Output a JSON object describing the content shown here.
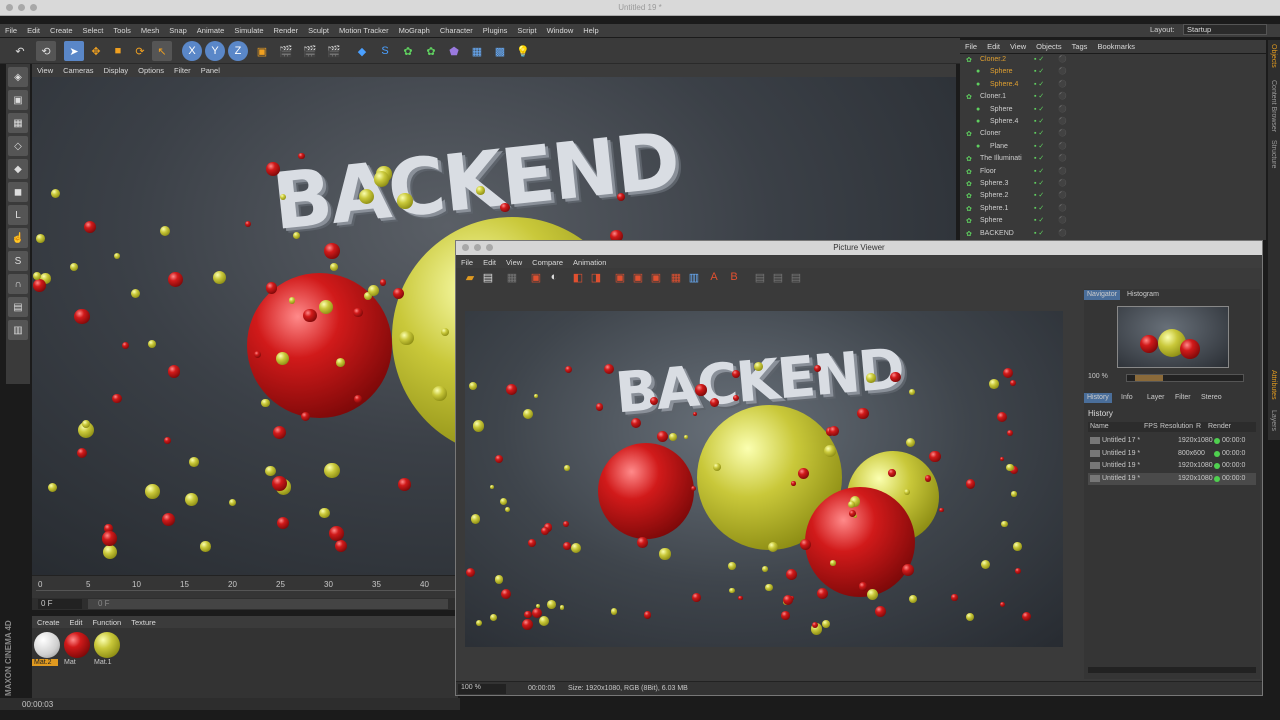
{
  "window": {
    "title": "Untitled 19 *"
  },
  "menus": [
    "File",
    "Edit",
    "Create",
    "Select",
    "Tools",
    "Mesh",
    "Snap",
    "Animate",
    "Simulate",
    "Render",
    "Sculpt",
    "Motion Tracker",
    "MoGraph",
    "Character",
    "Plugins",
    "Script",
    "Window",
    "Help"
  ],
  "layout": {
    "label": "Layout:",
    "value": "Startup"
  },
  "viewport": {
    "menus": [
      "View",
      "Cameras",
      "Display",
      "Options",
      "Filter",
      "Panel"
    ],
    "scene_text": "BACKEND"
  },
  "timeline": {
    "ticks": [
      "0",
      "5",
      "10",
      "15",
      "20",
      "25",
      "30",
      "35",
      "40"
    ],
    "frame": "0 F",
    "frame2": "0 F"
  },
  "materials": {
    "menus": [
      "Create",
      "Edit",
      "Function",
      "Texture"
    ],
    "items": [
      "Mat.2",
      "Mat",
      "Mat.1"
    ]
  },
  "status": {
    "time": "00:00:03"
  },
  "brand": "MAXON CINEMA 4D",
  "objects": {
    "menus": [
      "File",
      "Edit",
      "View",
      "Objects",
      "Tags",
      "Bookmarks"
    ],
    "items": [
      {
        "name": "Cloner.2",
        "indent": 0,
        "color": "#e0a030"
      },
      {
        "name": "Sphere",
        "indent": 1,
        "color": "#e0a030"
      },
      {
        "name": "Sphere.4",
        "indent": 1,
        "color": "#e0a030"
      },
      {
        "name": "Cloner.1",
        "indent": 0,
        "color": "#cfcfcf"
      },
      {
        "name": "Sphere",
        "indent": 1,
        "color": "#cfcfcf"
      },
      {
        "name": "Sphere.4",
        "indent": 1,
        "color": "#cfcfcf"
      },
      {
        "name": "Cloner",
        "indent": 0,
        "color": "#cfcfcf"
      },
      {
        "name": "Plane",
        "indent": 1,
        "color": "#cfcfcf"
      },
      {
        "name": "The Illuminati",
        "indent": 0,
        "color": "#cfcfcf"
      },
      {
        "name": "Floor",
        "indent": 0,
        "color": "#cfcfcf"
      },
      {
        "name": "Sphere.3",
        "indent": 0,
        "color": "#cfcfcf"
      },
      {
        "name": "Sphere.2",
        "indent": 0,
        "color": "#cfcfcf"
      },
      {
        "name": "Sphere.1",
        "indent": 0,
        "color": "#cfcfcf"
      },
      {
        "name": "Sphere",
        "indent": 0,
        "color": "#cfcfcf"
      },
      {
        "name": "BACKEND",
        "indent": 0,
        "color": "#cfcfcf"
      }
    ]
  },
  "side_tabs": [
    "Objects",
    "Content Browser",
    "Structure",
    "Attributes",
    "Layers"
  ],
  "picture_viewer": {
    "title": "Picture Viewer",
    "menus": [
      "File",
      "Edit",
      "View",
      "Compare",
      "Animation"
    ],
    "scene_text": "BACKEND",
    "nav_tabs": [
      "Navigator",
      "Histogram"
    ],
    "zoom": "100 %",
    "tabs": [
      "History",
      "Info",
      "Layer",
      "Filter",
      "Stereo"
    ],
    "history_label": "History",
    "columns": [
      "Name",
      "FPS",
      "Resolution",
      "R",
      "Render"
    ],
    "rows": [
      {
        "name": "Untitled 17 *",
        "res": "1920x1080",
        "time": "00:00:0"
      },
      {
        "name": "Untitled 19 *",
        "res": "800x600",
        "time": "00:00:0"
      },
      {
        "name": "Untitled 19 *",
        "res": "1920x1080",
        "time": "00:00:0"
      },
      {
        "name": "Untitled 19 *",
        "res": "1920x1080",
        "time": "00:00:0"
      }
    ],
    "bottom_zoom": "100 %",
    "bottom_time": "00:00:05",
    "bottom_info": "Size: 1920x1080, RGB (8Bit), 6.03 MB"
  }
}
